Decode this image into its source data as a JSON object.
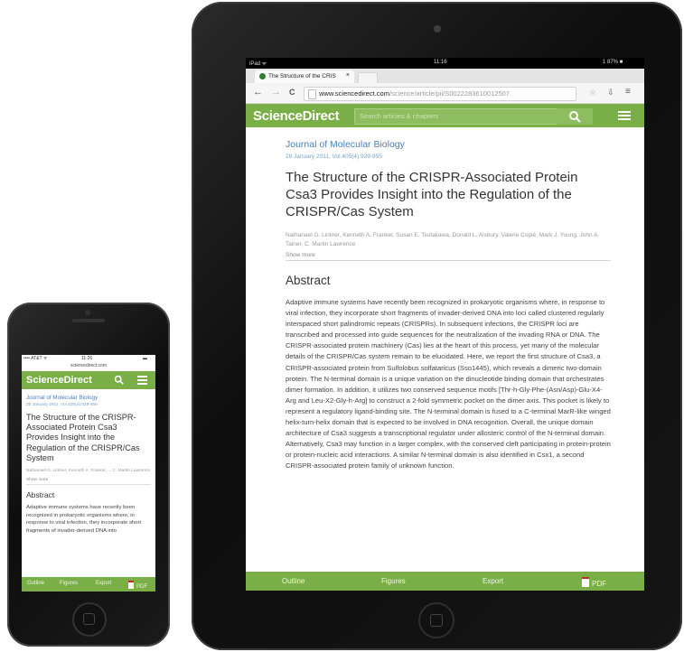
{
  "tablet": {
    "status": {
      "carrier": "iPad ᯤ",
      "time": "11:16",
      "battery": "1 87% ■"
    },
    "tab": {
      "title": "The Structure of the CRIS",
      "close": "×"
    },
    "nav": {
      "back": "←",
      "forward": "→",
      "reload": "C"
    },
    "url": {
      "host": "www.sciencedirect.com",
      "path": "/science/article/pii/S0022283610012507"
    },
    "toolbar_icons": [
      "☆",
      "⇩",
      "≡"
    ],
    "header": {
      "logo": "ScienceDirect",
      "search_placeholder": "Search articles & chapters"
    },
    "article": {
      "journal": "Journal of Molecular Biology",
      "date": "28 January 2011, Vol.405(4):939-955",
      "title": "The Structure of the CRISPR-Associated Protein Csa3 Provides Insight into the Regulation of the CRISPR/Cas System",
      "authors": "Nathanael G. Lintner, Kenneth A. Frankel, Susan E. Tsutakawa, Donald L. Alsbury, Valérie Copié, Mark J. Young, John A. Tainer, C. Martin Lawrence",
      "show_more": "Show more",
      "abstract_heading": "Abstract",
      "abstract": "Adaptive immune systems have recently been recognized in prokaryotic organisms where, in response to viral infection, they incorporate short fragments of invader-derived DNA into loci called clustered regularly interspaced short palindromic repeats (CRISPRs). In subsequent infections, the CRISPR loci are transcribed and processed into guide sequences for the neutralization of the invading RNA or DNA. The CRISPR-associated protein machinery (Cas) lies at the heart of this process, yet many of the molecular details of the CRISPR/Cas system remain to be elucidated. Here, we report the first structure of Csa3, a CRISPR-associated protein from Sulfolobus solfataricus (Sso1445), which reveals a dimeric two-domain protein. The N-terminal domain is a unique variation on the dinucleotide binding domain that orchestrates dimer formation. In addition, it utilizes two conserved sequence motifs [Thr-h-Gly-Phe-(Asn/Asp)-Glu-X4-Arg and Leu-X2-Gly-h-Arg] to construct a 2-fold symmetric pocket on the dimer axis. This pocket is likely to represent a regulatory ligand-binding site. The N-terminal domain is fused to a C-terminal MarR-like winged helix-turn-helix domain that is expected to be involved in DNA recognition. Overall, the unique domain architecture of Csa3 suggests a transcriptional regulator under allosteric control of the N-terminal domain. Alternatively, Csa3 may function in a larger complex, with the conserved cleft participating in protein-protein or protein-nucleic acid interactions. A similar N-terminal domain is also identified in Csx1, a second CRISPR-associated protein family of unknown function."
    },
    "bottom": {
      "outline": "Outline",
      "figures": "Figures",
      "export": "Export",
      "pdf": "PDF"
    }
  },
  "phone": {
    "status": {
      "carrier": "•••• AT&T ᯤ",
      "time": "11:26",
      "battery": "▬"
    },
    "url": "sciencedirect.com",
    "header": {
      "logo": "ScienceDirect",
      "search_icon": "search-icon",
      "menu_icon": "menu-icon"
    },
    "article": {
      "journal": "Journal of Molecular Biology",
      "date": "28 January 2011, Vol.405(4):939-955",
      "title": "The Structure of the CRISPR-Associated Protein Csa3 Provides Insight into the Regulation of the CRISPR/Cas System",
      "authors": "Nathanael G. Lintner, Kenneth A. Frankel, ... C. Martin Lawrence",
      "show_more": "Show more",
      "abstract_heading": "Abstract",
      "abstract": "Adaptive immune systems have recently been recognized in prokaryotic organisms where, in response to viral infection, they incorporate short fragments of invader-derived DNA into"
    },
    "bottom": {
      "outline": "Outline",
      "figures": "Figures",
      "export": "Export",
      "pdf": "PDF"
    }
  },
  "colors": {
    "brand_green": "#7aae47",
    "link_blue": "#4b7fb9"
  }
}
